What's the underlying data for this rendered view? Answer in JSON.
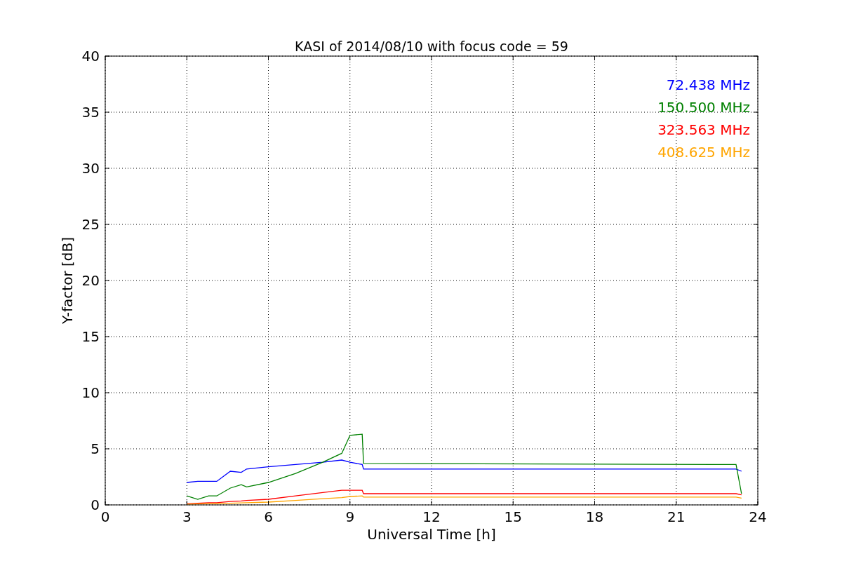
{
  "figure": {
    "chart_data": {
      "type": "line",
      "title": "KASI of 2014/08/10 with focus code = 59",
      "xlabel": "Universal Time [h]",
      "ylabel": "Y-factor [dB]",
      "x": [
        3,
        3.4,
        3.8,
        4.1,
        4.6,
        5,
        5.2,
        6,
        7,
        8,
        8.7,
        9,
        9.45,
        9.5,
        23.2,
        23.4
      ],
      "series": [
        {
          "name": "72.438 MHz",
          "color": "#0000ff",
          "values": [
            2.0,
            2.1,
            2.1,
            2.1,
            3.0,
            2.9,
            3.2,
            3.4,
            3.6,
            3.8,
            4.0,
            3.8,
            3.6,
            3.2,
            3.2,
            3.0
          ]
        },
        {
          "name": "150.500 MHz",
          "color": "#008000",
          "values": [
            0.8,
            0.5,
            0.8,
            0.8,
            1.5,
            1.8,
            1.6,
            2.0,
            2.8,
            3.8,
            4.6,
            6.2,
            6.3,
            3.7,
            3.6,
            1.0
          ]
        },
        {
          "name": "323.563 MHz",
          "color": "#ff0000",
          "values": [
            0.1,
            0.15,
            0.2,
            0.2,
            0.3,
            0.35,
            0.4,
            0.5,
            0.8,
            1.1,
            1.3,
            1.3,
            1.3,
            1.0,
            1.0,
            0.9
          ]
        },
        {
          "name": "408.625 MHz",
          "color": "#ffa500",
          "values": [
            0.05,
            0.08,
            0.1,
            0.1,
            0.15,
            0.18,
            0.2,
            0.25,
            0.4,
            0.55,
            0.65,
            0.75,
            0.8,
            0.7,
            0.7,
            0.6
          ]
        }
      ],
      "xlim": [
        0,
        24
      ],
      "ylim": [
        0,
        40
      ],
      "xticks": [
        0,
        3,
        6,
        9,
        12,
        15,
        18,
        21,
        24
      ],
      "yticks": [
        0,
        5,
        10,
        15,
        20,
        25,
        30,
        35,
        40
      ],
      "grid": true
    }
  }
}
